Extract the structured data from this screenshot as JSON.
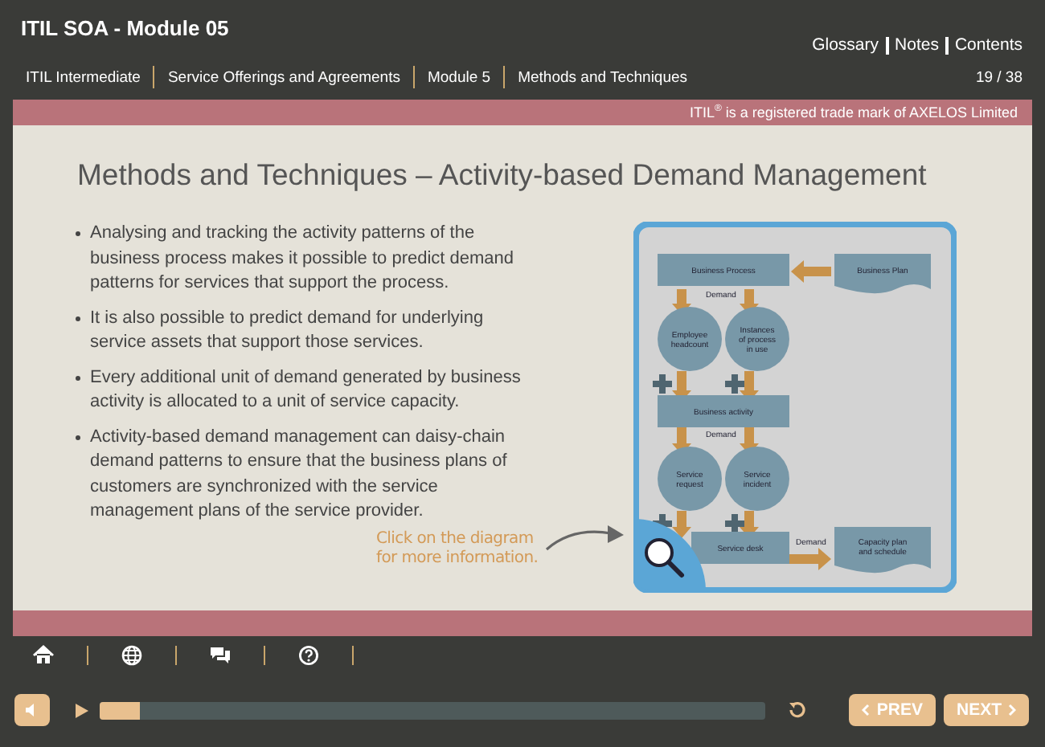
{
  "header": {
    "title": "ITIL SOA - Module 05",
    "links": [
      "Glossary",
      "Notes",
      "Contents"
    ]
  },
  "breadcrumb": {
    "items": [
      "ITIL Intermediate",
      "Service Offerings and Agreements",
      "Module 5",
      "Methods and Techniques"
    ],
    "page": "19 / 38"
  },
  "trademark": "ITIL$^{®}$ is a registered trade mark of AXELOS Limited",
  "slide": {
    "heading": "Methods and Techniques – Activity-based Demand Management",
    "bullets": [
      "Analysing and tracking the activity patterns of the business process makes it possible to predict demand patterns for services that support the process.",
      " It is also possible to predict demand for underlying service assets that support those services.",
      "Every additional unit of demand generated by business activity is allocated to a unit of service capacity.",
      "Activity-based demand management can daisy-chain demand patterns to ensure that the business plans of customers are synchronized with the service management plans of the service provider."
    ],
    "hint": "Click on the diagram for more information.",
    "diagram": {
      "nodes": [
        {
          "kind": "rect",
          "label": "Business Process"
        },
        {
          "kind": "doc",
          "label": "Business Plan"
        },
        {
          "kind": "circle",
          "label": "Employee headcount"
        },
        {
          "kind": "circle",
          "label": "Instances of process in use"
        },
        {
          "kind": "rect",
          "label": "Business activity"
        },
        {
          "kind": "circle",
          "label": "Service request"
        },
        {
          "kind": "circle",
          "label": "Service incident"
        },
        {
          "kind": "rect",
          "label": "Service desk"
        },
        {
          "kind": "doc",
          "label": "Capacity plan and schedule"
        }
      ],
      "demand_labels": [
        "Demand",
        "Demand",
        "Demand"
      ]
    }
  },
  "player": {
    "progress": {
      "level": 0.06
    },
    "buttons": [
      "PREV",
      "NEXT"
    ]
  }
}
